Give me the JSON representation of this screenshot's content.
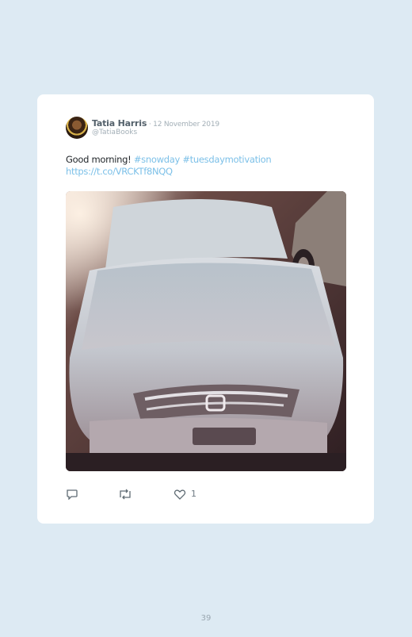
{
  "tweet": {
    "author_name": "Tatia Harris",
    "separator": " · ",
    "date": "12 November 2019",
    "handle": "@TatiaBooks",
    "text_plain": "Good morning! ",
    "hashtag_1": "#snowday",
    "hashtag_2": "#tuesdaymotivation",
    "link": "https://t.co/VRCKTf8NQQ",
    "photo_icon": "photo-of-snow-covered-car",
    "actions": {
      "reply_icon": "reply-icon",
      "retweet_icon": "retweet-icon",
      "like_icon": "heart-icon",
      "like_count": "1"
    }
  },
  "page": {
    "number": "39"
  },
  "colors": {
    "background": "#ddeaf3",
    "card": "#ffffff",
    "link": "#7cc0e8",
    "text": "#1f2428"
  }
}
